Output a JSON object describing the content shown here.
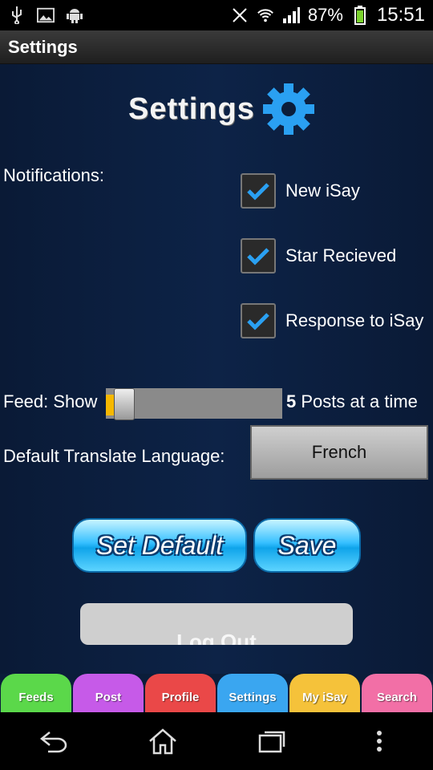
{
  "status_bar": {
    "icons_left": [
      "usb-icon",
      "image-icon",
      "android-icon"
    ],
    "battery": "87%",
    "time": "15:51"
  },
  "action_bar": {
    "title": "Settings"
  },
  "logo": {
    "text": "Settings",
    "icon": "gear-icon",
    "color": "#2aa0f2"
  },
  "notifications": {
    "label": "Notifications:",
    "options": [
      {
        "label": "New iSay",
        "checked": true
      },
      {
        "label": "Star Recieved",
        "checked": true
      },
      {
        "label": "Response to iSay",
        "checked": true
      }
    ]
  },
  "feed": {
    "prefix": "Feed:  Show",
    "value": "5",
    "suffix": "Posts at a time",
    "slider_fraction": 0.05
  },
  "language": {
    "label": "Default Translate Language:",
    "value": "French"
  },
  "buttons": {
    "set_default": "Set Default",
    "save": "Save",
    "logout": "Log Out"
  },
  "tabs": [
    {
      "label": "Feeds",
      "color": "#5bd84a"
    },
    {
      "label": "Post",
      "color": "#c65ae8"
    },
    {
      "label": "Profile",
      "color": "#ea4848"
    },
    {
      "label": "Settings",
      "color": "#3aa6f0"
    },
    {
      "label": "My iSay",
      "color": "#f5c23a"
    },
    {
      "label": "Search",
      "color": "#f26fa6"
    }
  ]
}
